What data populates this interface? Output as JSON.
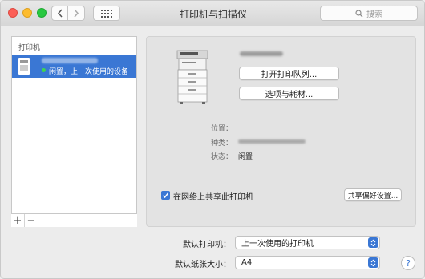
{
  "window": {
    "title": "打印机与扫描仪"
  },
  "toolbar": {
    "search_placeholder": "搜索"
  },
  "sidebar": {
    "header": "打印机",
    "printers": [
      {
        "status": "闲置，上一次使用的设备",
        "selected": true
      }
    ],
    "add_label": "+",
    "remove_label": "−"
  },
  "detail": {
    "open_queue_label": "打开打印队列...",
    "options_label": "选项与耗材...",
    "location_label": "位置：",
    "kind_label": "种类：",
    "status_label": "状态：",
    "status_value": "闲置",
    "share_label": "在网络上共享此打印机",
    "share_checked": true,
    "share_prefs_label": "共享偏好设置..."
  },
  "bottom": {
    "default_printer_label": "默认打印机：",
    "default_printer_value": "上一次使用的打印机",
    "default_paper_label": "默认纸张大小：",
    "default_paper_value": "A4",
    "help_label": "?"
  },
  "colors": {
    "accent": "#3a77d4",
    "selection": "#3a77d4"
  }
}
